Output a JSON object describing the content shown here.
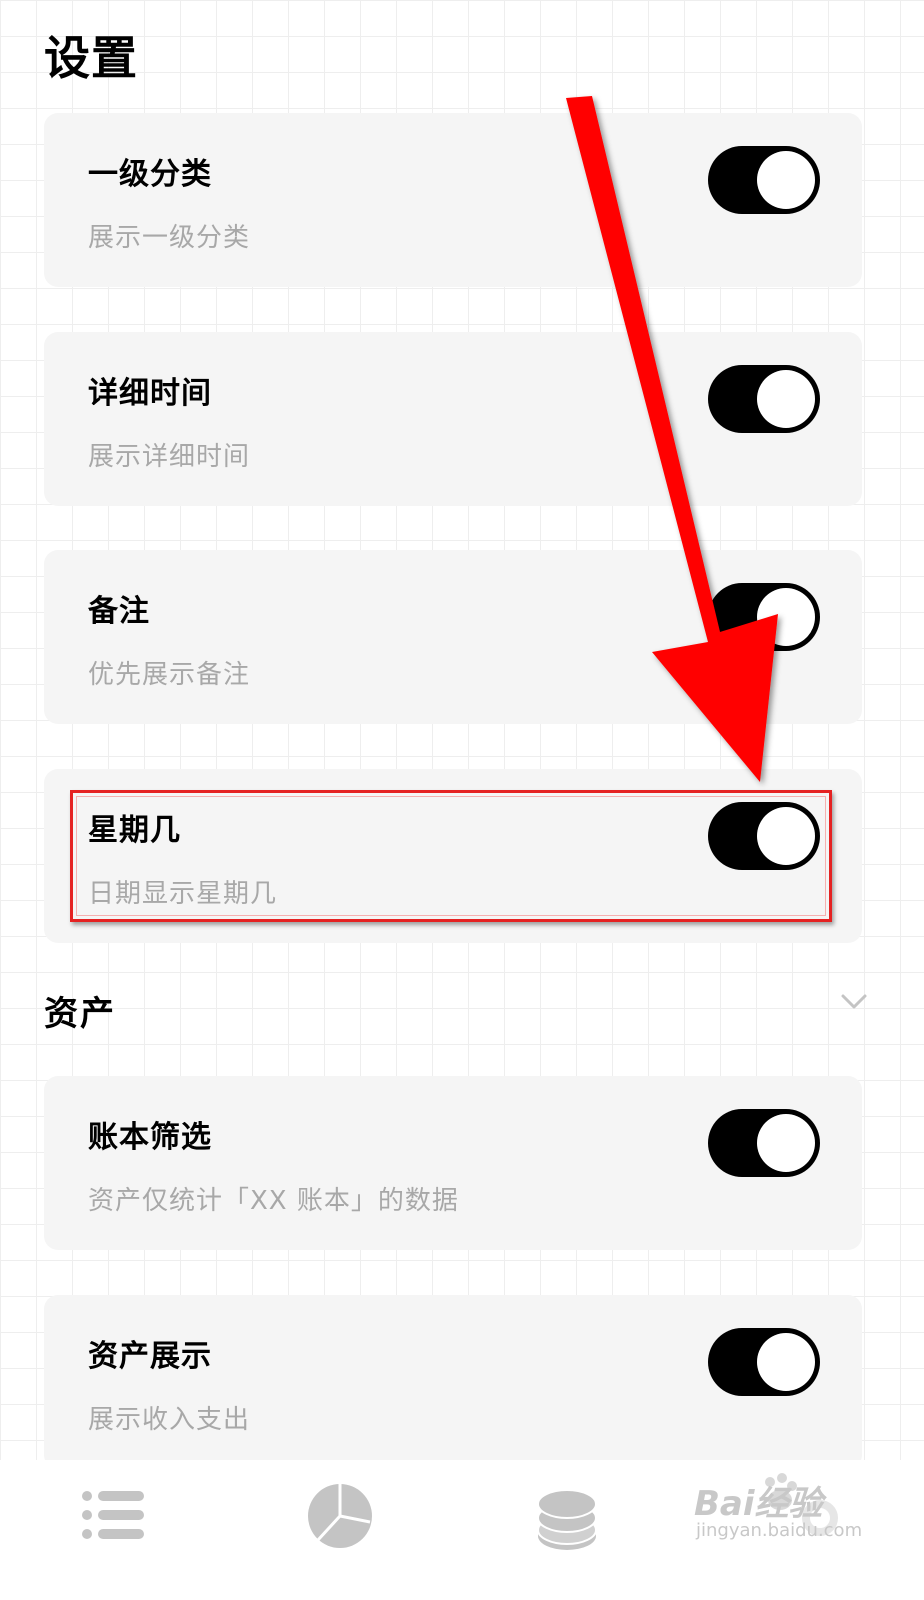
{
  "page": {
    "title": "设置"
  },
  "settings": [
    {
      "title": "一级分类",
      "desc": "展示一级分类",
      "enabled": true
    },
    {
      "title": "详细时间",
      "desc": "展示详细时间",
      "enabled": true
    },
    {
      "title": "备注",
      "desc": "优先展示备注",
      "enabled": true
    },
    {
      "title": "星期几",
      "desc": "日期显示星期几",
      "enabled": true
    }
  ],
  "assets_section": {
    "title": "资产",
    "items": [
      {
        "title": "账本筛选",
        "desc": "资产仅统计「XX 账本」的数据",
        "enabled": true
      },
      {
        "title": "资产展示",
        "desc": "展示收入支出",
        "enabled": true
      }
    ]
  },
  "tabbar": {
    "icons": [
      "list-icon",
      "pie-chart-icon",
      "coins-stack-icon",
      "settings-icon"
    ]
  },
  "watermark": {
    "brand": "Bai经验",
    "url": "jingyan.baidu.com"
  },
  "colors": {
    "toggle_on": "#000000",
    "card_bg": "#f5f5f5",
    "desc_text": "#a8a8a8",
    "annotation": "#e52222"
  }
}
